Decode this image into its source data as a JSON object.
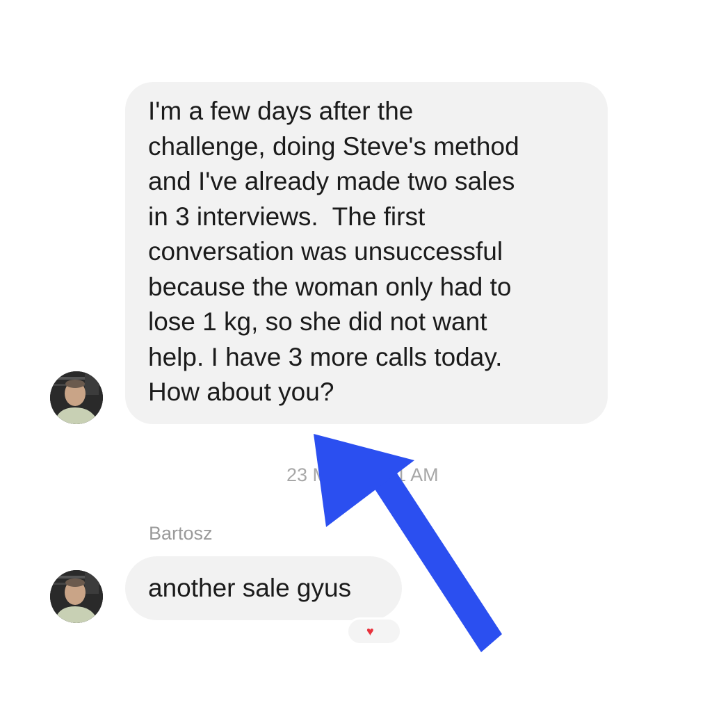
{
  "messages": [
    {
      "lines": [
        "I'm a few days after the",
        "challenge, doing Steve's method",
        "and I've already made two sales",
        "in 3 interviews.  The first",
        "conversation was unsuccessful",
        "because the woman only had to",
        "lose 1 kg, so she did not want",
        "help. I have 3 more calls today.",
        "How about you?"
      ]
    },
    {
      "sender": "Bartosz",
      "text": "another sale gyus"
    }
  ],
  "timestamp": "23 Mar at 5:11 AM",
  "reaction": {
    "icon": "heart-icon",
    "color": "#e8323c"
  },
  "annotation": {
    "icon": "arrow-icon",
    "color": "#2b4ff0"
  }
}
